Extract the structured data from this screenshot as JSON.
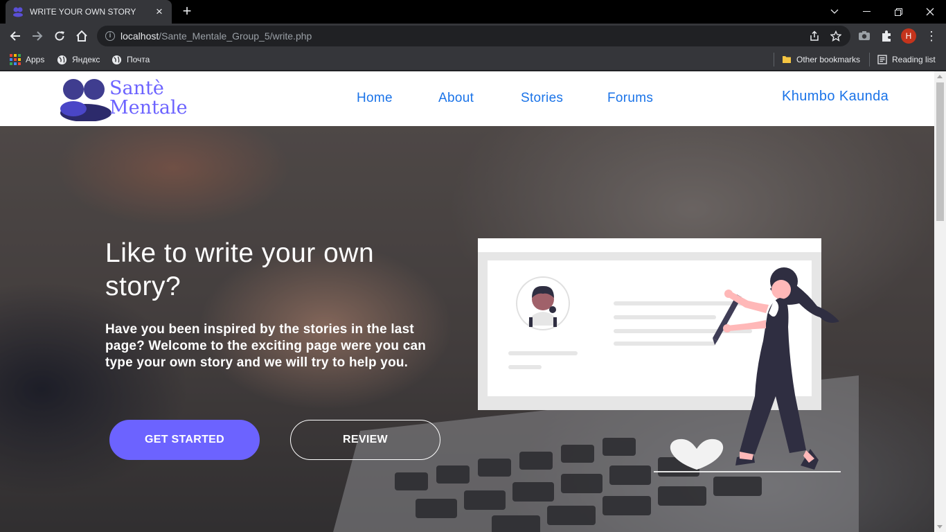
{
  "browser": {
    "tab_title": "WRITE YOUR OWN STORY",
    "url_host": "localhost",
    "url_path": "/Sante_Mentale_Group_5/write.php",
    "profile_initial": "H",
    "bookmarks": {
      "apps": "Apps",
      "yandex": "Яндекс",
      "pochta": "Почта",
      "other": "Other bookmarks",
      "reading_list": "Reading list"
    }
  },
  "site": {
    "logo_line1": "Santè",
    "logo_line2": "Mentale",
    "nav": [
      "Home",
      "About",
      "Stories",
      "Forums"
    ],
    "user_name": "Khumbo Kaunda",
    "brand_color": "#6c63ff",
    "link_color": "#1a73e8"
  },
  "hero": {
    "title": "Like to write your own story?",
    "text": "Have you been inspired by the stories in the last page? Welcome to the exciting page were you can type your own story and we will try to help you.",
    "primary_button": "GET STARTED",
    "secondary_button": "REVIEW"
  }
}
